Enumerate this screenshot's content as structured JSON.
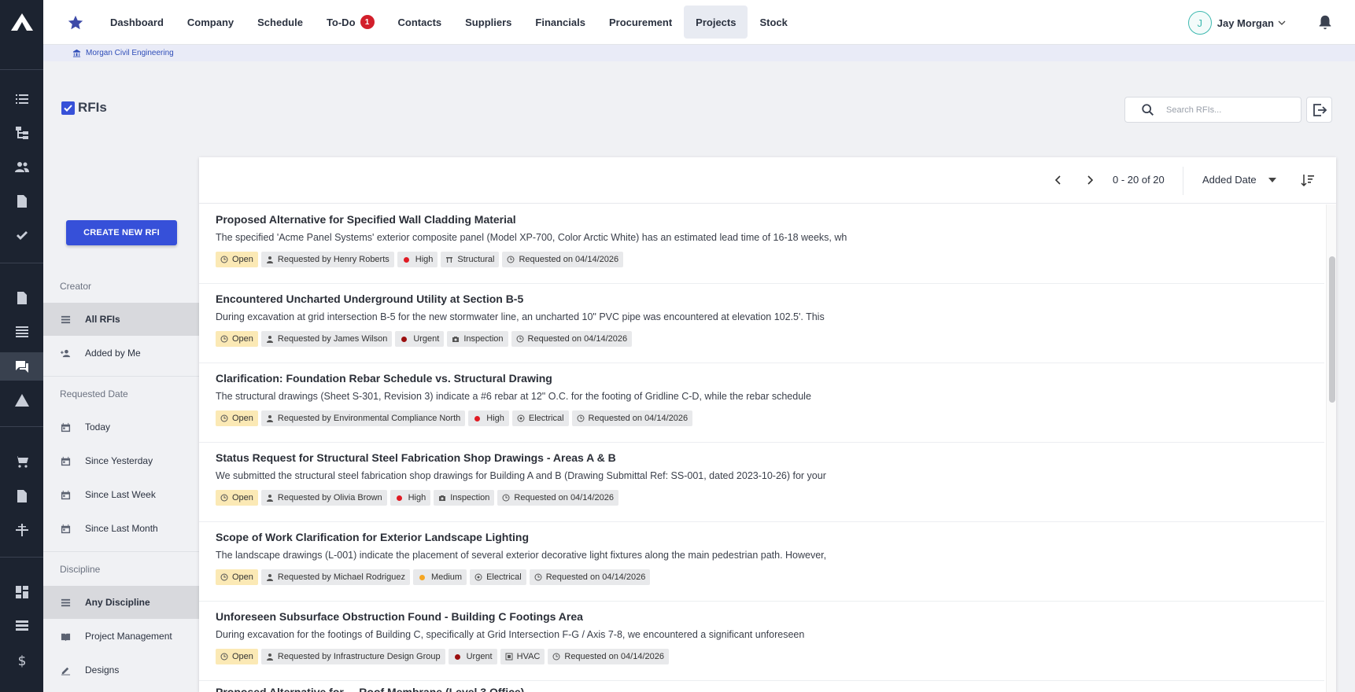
{
  "app": {
    "nav": [
      "Dashboard",
      "Company",
      "Schedule",
      "To-Do",
      "Contacts",
      "Suppliers",
      "Financials",
      "Procurement",
      "Projects",
      "Stock"
    ],
    "todo_badge": "1",
    "active_nav": "Projects",
    "user_initial": "J",
    "user_name": "Jay Morgan"
  },
  "breadcrumb": "Morgan Civil Engineering",
  "page": {
    "title": "RFIs",
    "search_placeholder": "Search RFIs..."
  },
  "sidebar": {
    "create_button": "CREATE NEW RFI",
    "sections": {
      "creator": {
        "heading": "Creator",
        "items": [
          "All RFIs",
          "Added by Me"
        ]
      },
      "requested_date": {
        "heading": "Requested Date",
        "items": [
          "Today",
          "Since Yesterday",
          "Since Last Week",
          "Since Last Month"
        ]
      },
      "discipline": {
        "heading": "Discipline",
        "items": [
          "Any Discipline",
          "Project Management",
          "Designs"
        ]
      }
    }
  },
  "list": {
    "range": "0 - 20 of 20",
    "sort_by": "Added Date",
    "rows": [
      {
        "title": "Proposed Alternative for Specified Wall Cladding Material",
        "desc": "The specified 'Acme Panel Systems' exterior composite panel (Model XP-700, Color Arctic White) has an estimated lead time of 16-18 weeks, wh",
        "status": "Open",
        "requester": "Requested by Henry Roberts",
        "priority": "High",
        "discipline": "Structural",
        "date": "Requested on 04/14/2026"
      },
      {
        "title": "Encountered Uncharted Underground Utility at Section B-5",
        "desc": "During excavation at grid intersection B-5 for the new stormwater line, an uncharted 10\" PVC pipe was encountered at elevation 102.5'. This",
        "status": "Open",
        "requester": "Requested by James Wilson",
        "priority": "Urgent",
        "discipline": "Inspection",
        "date": "Requested on 04/14/2026"
      },
      {
        "title": "Clarification: Foundation Rebar Schedule vs. Structural Drawing",
        "desc": "The structural drawings (Sheet S-301, Revision 3) indicate a #6 rebar at 12\" O.C. for the footing of Gridline C-D, while the rebar schedule",
        "status": "Open",
        "requester": "Requested by Environmental Compliance North",
        "priority": "High",
        "discipline": "Electrical",
        "date": "Requested on 04/14/2026"
      },
      {
        "title": "Status Request for Structural Steel Fabrication Shop Drawings - Areas A & B",
        "desc": "We submitted the structural steel fabrication shop drawings for Building A and B (Drawing Submittal Ref: SS-001, dated 2023-10-26) for your",
        "status": "Open",
        "requester": "Requested by Olivia Brown",
        "priority": "High",
        "discipline": "Inspection",
        "date": "Requested on 04/14/2026"
      },
      {
        "title": "Scope of Work Clarification for Exterior Landscape Lighting",
        "desc": "The landscape drawings (L-001) indicate the placement of several exterior decorative light fixtures along the main pedestrian path. However,",
        "status": "Open",
        "requester": "Requested by Michael Rodriguez",
        "priority": "Medium",
        "discipline": "Electrical",
        "date": "Requested on 04/14/2026"
      },
      {
        "title": "Unforeseen Subsurface Obstruction Found - Building C Footings Area",
        "desc": "During excavation for the footings of Building C, specifically at Grid Intersection F-G / Axis 7-8, we encountered a significant unforeseen",
        "status": "Open",
        "requester": "Requested by Infrastructure Design Group",
        "priority": "Urgent",
        "discipline": "HVAC",
        "date": "Requested on 04/14/2026"
      }
    ],
    "partial_title": "Proposed Alternative for ... Roof Membrane (Level 3 Office)"
  },
  "colors": {
    "accent": "#3650d9",
    "priority_high": "#e01b24",
    "priority_urgent": "#9b0f0f",
    "priority_medium": "#f5a623",
    "status_open_bg": "#fbe9b5"
  },
  "icons": {
    "discipline": {
      "Structural": "beam-icon",
      "Inspection": "camera-icon",
      "Electrical": "plug-icon",
      "HVAC": "hvac-icon"
    }
  }
}
